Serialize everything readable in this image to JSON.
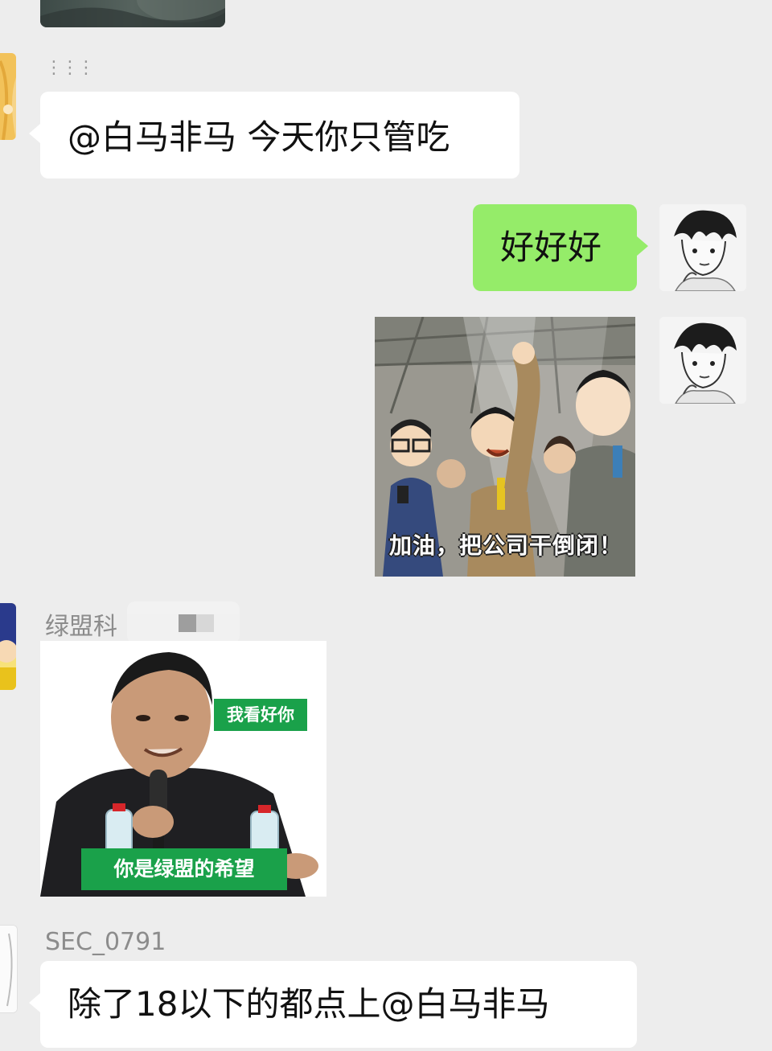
{
  "messages": {
    "m1": {
      "sender_placeholder": "⋮⋮⋮",
      "text": "@白马非马  今天你只管吃"
    },
    "m2": {
      "text": "好好好"
    },
    "m3": {
      "sticker_caption": "加油，把公司干倒闭！"
    },
    "m4": {
      "sender": "绿盟科",
      "sticker_top_label": "我看好你",
      "sticker_bottom_label": "你是绿盟的希望"
    },
    "m5": {
      "sender": "SEC_0791",
      "text": "除了18以下的都点上@白马非马"
    }
  },
  "colors": {
    "background": "#ededed",
    "bubble_self": "#95ec69",
    "bubble_other": "#ffffff",
    "sticker_green": "#1aa14a",
    "sender_name": "#8c8c8c"
  }
}
